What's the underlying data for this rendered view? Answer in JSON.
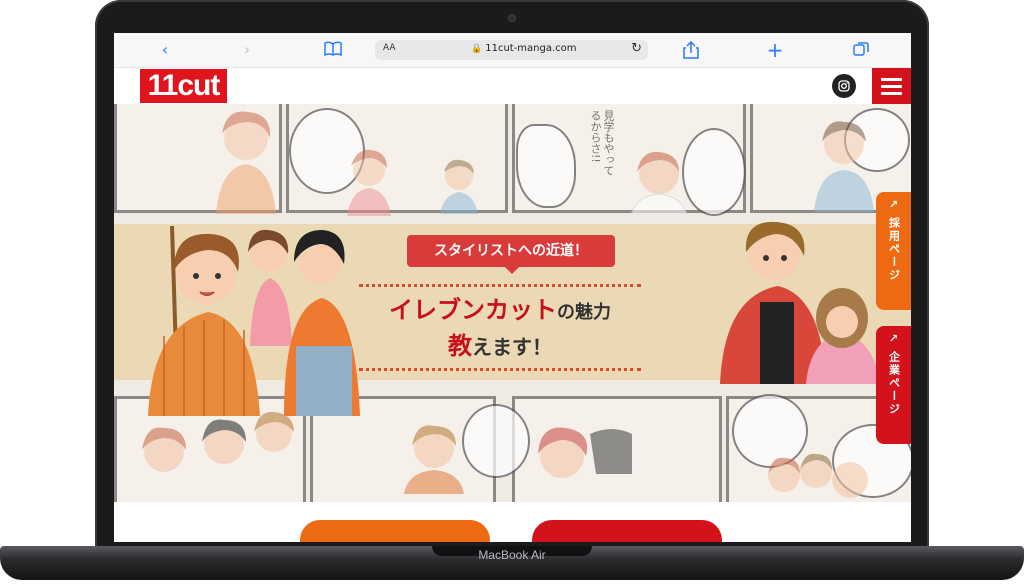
{
  "device": {
    "label": "MacBook Air"
  },
  "browser": {
    "text_size_label": "AA",
    "url": "11cut-manga.com",
    "icons": [
      "back-icon",
      "forward-icon",
      "bookmarks-icon",
      "lock-icon",
      "reload-icon",
      "share-icon",
      "new-tab-icon",
      "tabs-icon"
    ]
  },
  "site": {
    "logo": "11cut",
    "instagram_icon": "instagram-icon",
    "menu_icon": "hamburger-menu-icon"
  },
  "hero": {
    "tagline": "スタイリストへの近道！",
    "headline_red_1": "イレブンカット",
    "headline_1": "の魅力",
    "headline_red_2": "教",
    "headline_2": "えます！",
    "speech_text": "見学もやってるからさ!!"
  },
  "side_tabs": [
    {
      "label": "採用ページ",
      "icon": "external-link-icon",
      "color": "#ee6a12"
    },
    {
      "label": "企業ページ",
      "icon": "external-link-icon",
      "color": "#d3121b"
    }
  ],
  "colors": {
    "brand_red": "#e0141c",
    "accent_orange": "#ee6a12",
    "banner": "#e9d6aa"
  }
}
